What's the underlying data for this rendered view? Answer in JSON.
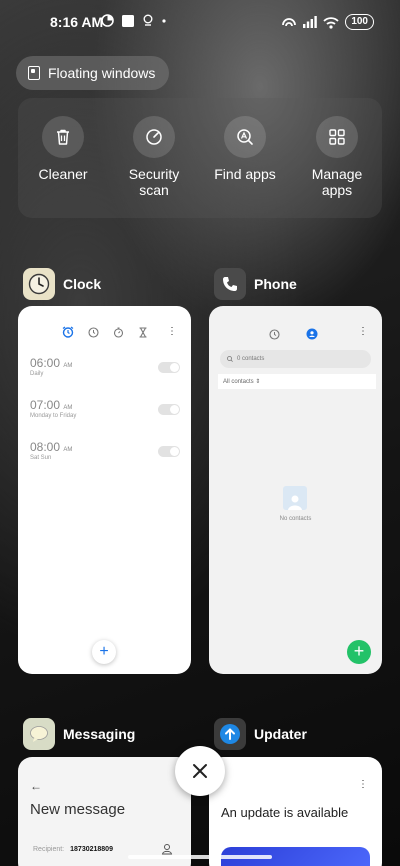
{
  "status_bar": {
    "time": "8:16 AM",
    "battery": "100"
  },
  "floating_windows": {
    "label": "Floating windows"
  },
  "quick_actions": [
    {
      "label": "Cleaner",
      "icon": "trash-icon"
    },
    {
      "label": "Security scan",
      "icon": "security-scan-icon"
    },
    {
      "label": "Find apps",
      "icon": "find-apps-icon"
    },
    {
      "label": "Manage apps",
      "icon": "grid-icon"
    }
  ],
  "apps": {
    "clock": {
      "title": "Clock",
      "alarms": [
        {
          "time": "06:00",
          "ampm": "AM",
          "repeat": "Daily"
        },
        {
          "time": "07:00",
          "ampm": "AM",
          "repeat": "Monday to Friday"
        },
        {
          "time": "08:00",
          "ampm": "AM",
          "repeat": "Sat Sun"
        }
      ],
      "fab": "+"
    },
    "phone": {
      "title": "Phone",
      "search_placeholder": "0 contacts",
      "filter": "All contacts",
      "empty": "No contacts",
      "fab": "+"
    },
    "messaging": {
      "title": "Messaging",
      "screen_title": "New message",
      "recipient_label": "Recipient:",
      "recipient_value": "18730218809"
    },
    "updater": {
      "title": "Updater",
      "headline": "An update is available"
    }
  },
  "colors": {
    "accent_blue": "#1a73e8",
    "phone_green": "#23c268",
    "updater_blue": "#2c3fd8"
  }
}
